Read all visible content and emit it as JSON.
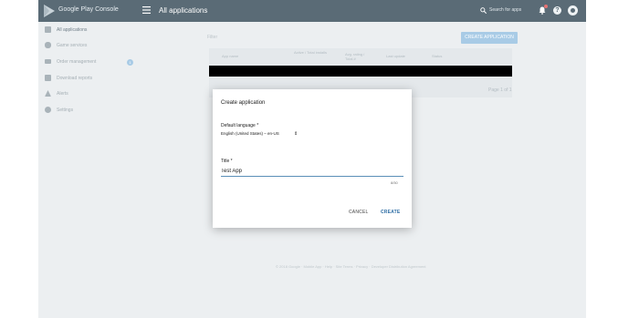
{
  "header": {
    "brand": "Google Play Console",
    "page_title": "All applications",
    "search_placeholder": "Search for apps",
    "help_glyph": "?"
  },
  "sidebar": {
    "items": [
      {
        "label": "All applications",
        "icon": "apps-icon"
      },
      {
        "label": "Game services",
        "icon": "gamepad-icon"
      },
      {
        "label": "Order management",
        "icon": "credit-card-icon"
      },
      {
        "label": "Download reports",
        "icon": "download-icon"
      },
      {
        "label": "Alerts",
        "icon": "warning-icon"
      },
      {
        "label": "Settings",
        "icon": "gear-icon"
      }
    ],
    "badge": "1"
  },
  "main": {
    "filter_label": "Filter",
    "create_application_label": "CREATE APPLICATION",
    "table_headers": [
      "App name",
      "Active / Total installs",
      "Avg. rating / Total #",
      "Last update",
      "Status"
    ],
    "page_count": "Page 1 of 1",
    "footer": "© 2018 Google · Mobile App · Help · Site Terms · Privacy · Developer Distribution Agreement"
  },
  "dialog": {
    "title": "Create application",
    "language_label": "Default language *",
    "language_value": "English (United States) – en-US",
    "title_label": "Title *",
    "title_value": "Test App",
    "char_count": "8/50",
    "cancel_label": "CANCEL",
    "create_label": "CREATE"
  },
  "colors": {
    "topbar": "#5a6b76",
    "background": "#eceff1",
    "accent": "#2e6da4",
    "button_disabled": "#a8cbe6"
  }
}
